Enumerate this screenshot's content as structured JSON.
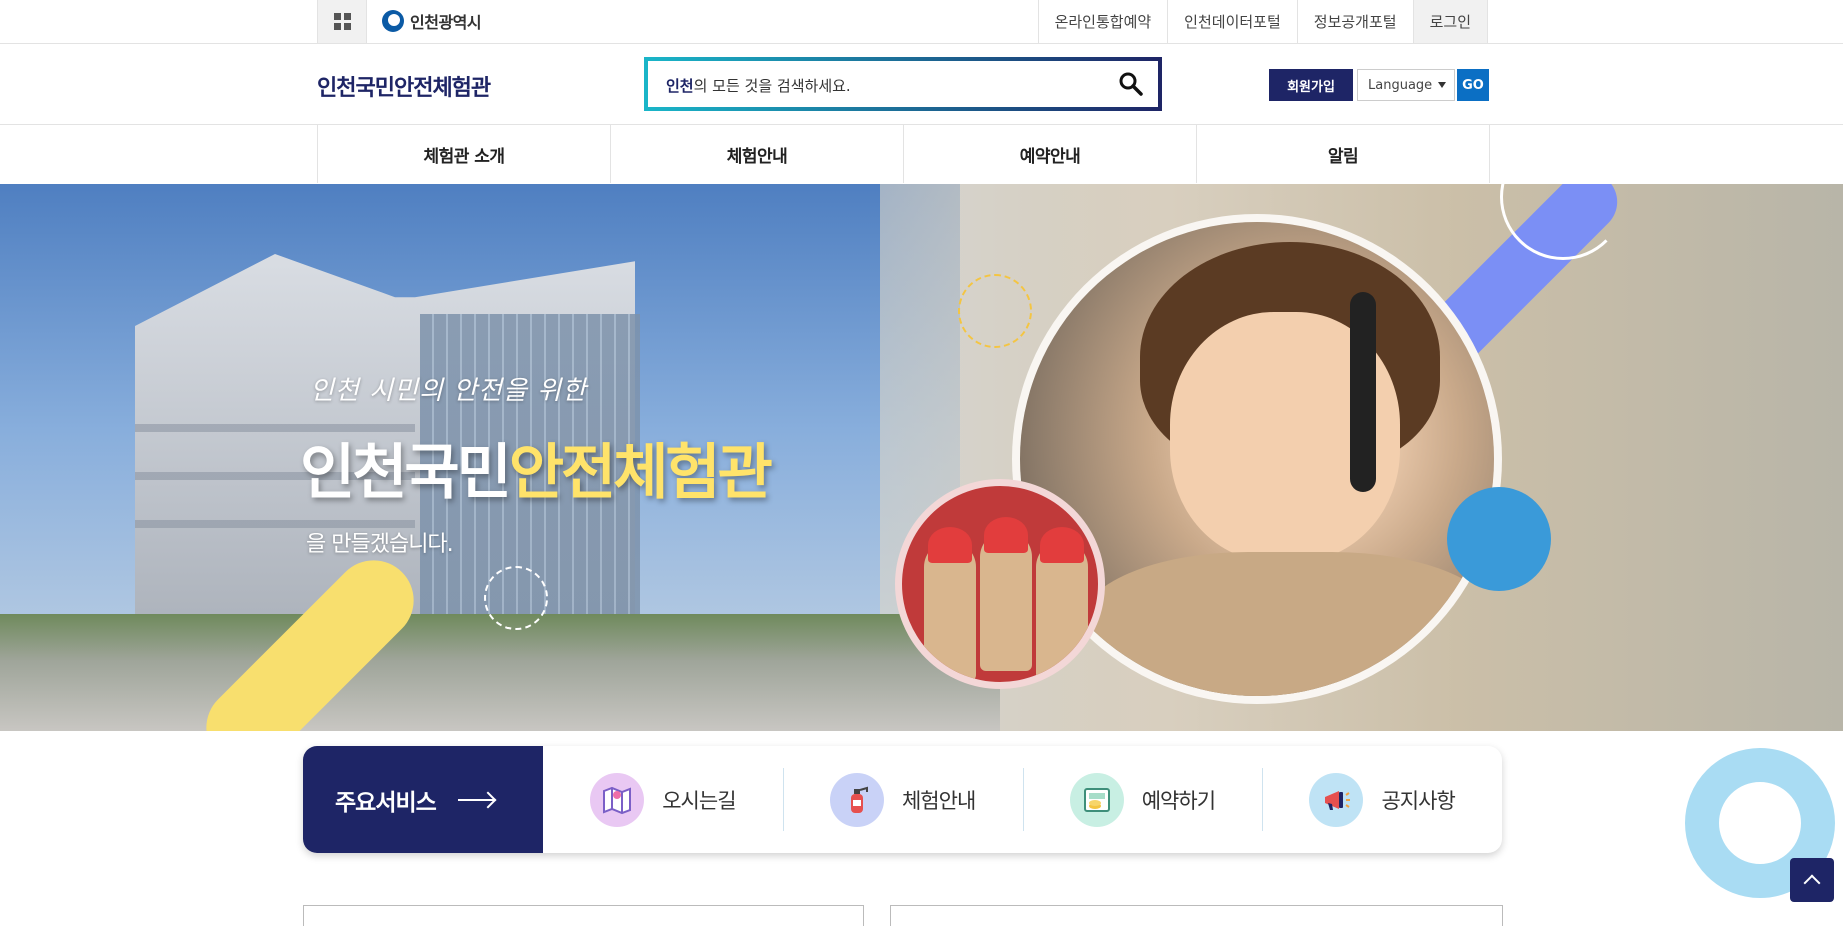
{
  "topbar": {
    "city_name": "인천광역시",
    "links": [
      "온라인통합예약",
      "인천데이터포털",
      "정보공개포털",
      "로그인"
    ]
  },
  "header": {
    "site_title": "인천국민안전체험관",
    "search": {
      "placeholder_bold": "인천",
      "placeholder_rest": "의 모든 것을 검색하세요."
    },
    "join_label": "회원가입",
    "language_label": "Language",
    "go_label": "GO"
  },
  "gnb": [
    "체험관 소개",
    "체험안내",
    "예약안내",
    "알림"
  ],
  "hero": {
    "subtitle": "인천 시민의 안전을 위한",
    "title_plain": "인천국민",
    "title_highlight": "안전체험관",
    "tail": "을 만들겠습니다."
  },
  "services": {
    "heading": "주요서비스",
    "items": [
      {
        "label": "오시는길",
        "icon": "map-icon",
        "color": "#e9c8f3"
      },
      {
        "label": "체험안내",
        "icon": "fire-extinguisher-icon",
        "color": "#c9d2f7"
      },
      {
        "label": "예약하기",
        "icon": "reservation-icon",
        "color": "#c8efe3"
      },
      {
        "label": "공지사항",
        "icon": "megaphone-icon",
        "color": "#bfe3f5"
      }
    ]
  },
  "colors": {
    "navy": "#1e2566",
    "teal": "#1ab5c8",
    "go_blue": "#0b6fc4",
    "highlight_yellow": "#ffe36a"
  }
}
